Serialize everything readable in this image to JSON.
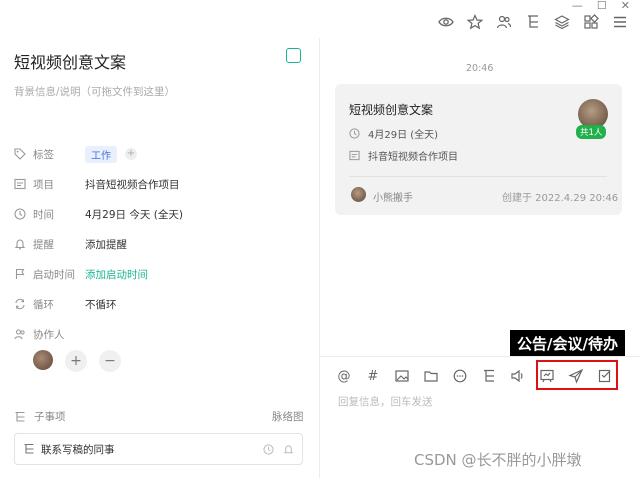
{
  "window": {
    "restore": "—",
    "maximize": "☐",
    "close": "✕"
  },
  "toolbar": {
    "icons": [
      "eye-icon",
      "star-icon",
      "users-icon",
      "subtask-icon",
      "layers-icon",
      "grid-icon",
      "menu-icon"
    ]
  },
  "task": {
    "title": "短视频创意文案",
    "description_placeholder": "背景信息/说明（可拖文件到这里）"
  },
  "properties": {
    "tag": {
      "label": "标签",
      "value": "工作",
      "add": "+"
    },
    "project": {
      "label": "项目",
      "value": "抖音短视频合作项目"
    },
    "time": {
      "label": "时间",
      "value": "4月29日 今天 (全天)"
    },
    "reminder": {
      "label": "提醒",
      "value": "添加提醒"
    },
    "start": {
      "label": "启动时间",
      "value": "添加启动时间"
    },
    "repeat": {
      "label": "循环",
      "value": "不循环"
    },
    "collaborators": {
      "label": "协作人",
      "add": "+",
      "remove": "−"
    }
  },
  "subtasks": {
    "label": "子事项",
    "mindmap": "脉络图",
    "input_value": "联系写稿的同事"
  },
  "chat": {
    "time": "20:46",
    "card": {
      "title": "短视频创意文案",
      "date": "4月29日 (全天)",
      "project": "抖音短视频合作项目",
      "badge": "共1人",
      "user": "小熊搬手",
      "created": "创建于 2022.4.29 20:46"
    },
    "reply_placeholder": "回复信息，回车发送",
    "tools": [
      "@",
      "#"
    ]
  },
  "annotation": {
    "label": "公告/会议/待办"
  },
  "watermark": "CSDN @长不胖的小胖墩",
  "colors": {
    "accent": "#1bb394",
    "badge": "#21b04b",
    "highlight_box": "#e01010"
  }
}
